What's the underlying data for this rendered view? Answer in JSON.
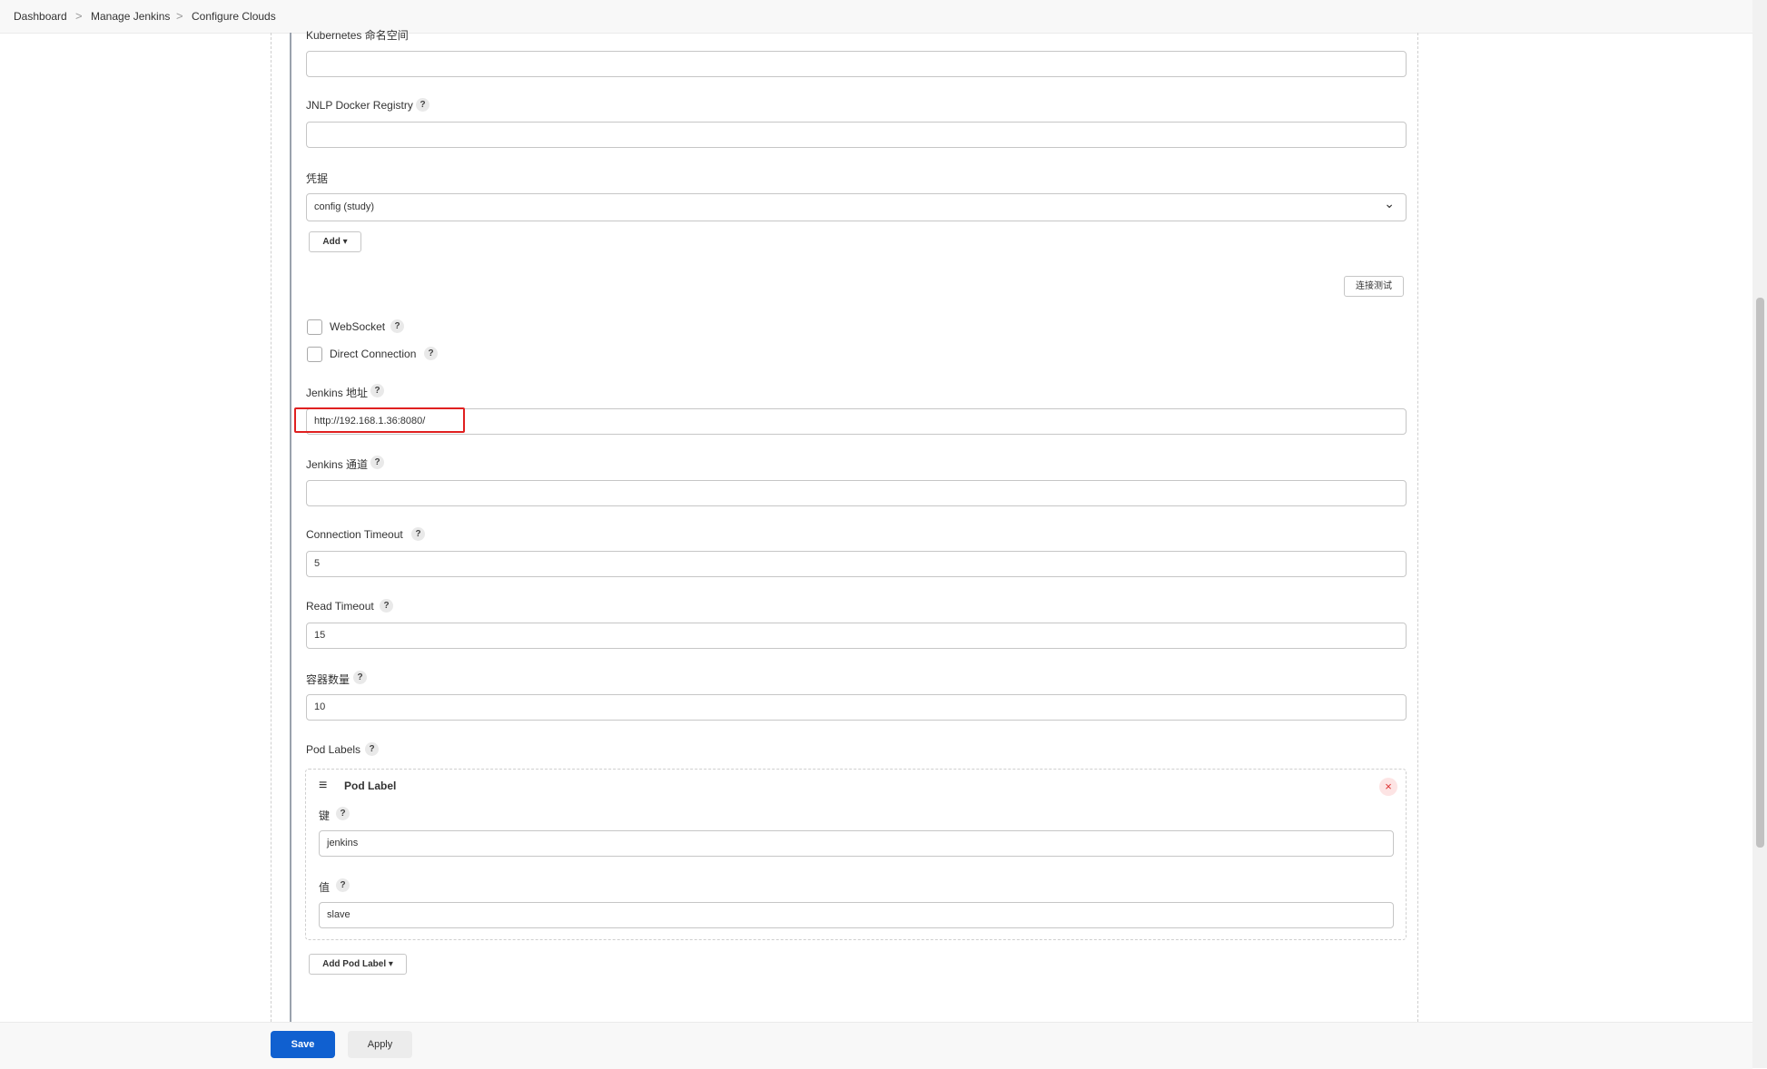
{
  "breadcrumb": {
    "items": [
      "Dashboard",
      "Manage Jenkins",
      "Configure Clouds"
    ],
    "separator": ">"
  },
  "form": {
    "k8s_namespace_label": "Kubernetes 命名空间",
    "jnlp_registry_label": "JNLP Docker Registry",
    "credentials_label": "凭据",
    "credentials_value": "config (study)",
    "add_button": "Add ▾",
    "test_connection_button": "连接测试",
    "websocket_label": "WebSocket",
    "direct_connection_label": "Direct Connection",
    "jenkins_url_label": "Jenkins 地址",
    "jenkins_url_value": "http://192.168.1.36:8080/",
    "jenkins_tunnel_label": "Jenkins 通道",
    "connection_timeout_label": "Connection Timeout",
    "connection_timeout_value": "5",
    "read_timeout_label": "Read Timeout",
    "read_timeout_value": "15",
    "container_cap_label": "容器数量",
    "container_cap_value": "10",
    "pod_labels_label": "Pod Labels",
    "pod_label": {
      "title": "Pod Label",
      "key_label": "键",
      "key_value": "jenkins",
      "value_label": "值",
      "value_value": "slave"
    },
    "add_pod_label_button": "Add Pod Label ▾"
  },
  "footer": {
    "save_button": "Save",
    "apply_button": "Apply"
  },
  "help_glyph": "?",
  "icons": {
    "close": "×",
    "drag": "≡",
    "chevron": "⌄"
  },
  "colors": {
    "primary": "#1060d0",
    "highlight": "#e02020",
    "close_bg": "#fde4e4",
    "close_fg": "#d33"
  }
}
